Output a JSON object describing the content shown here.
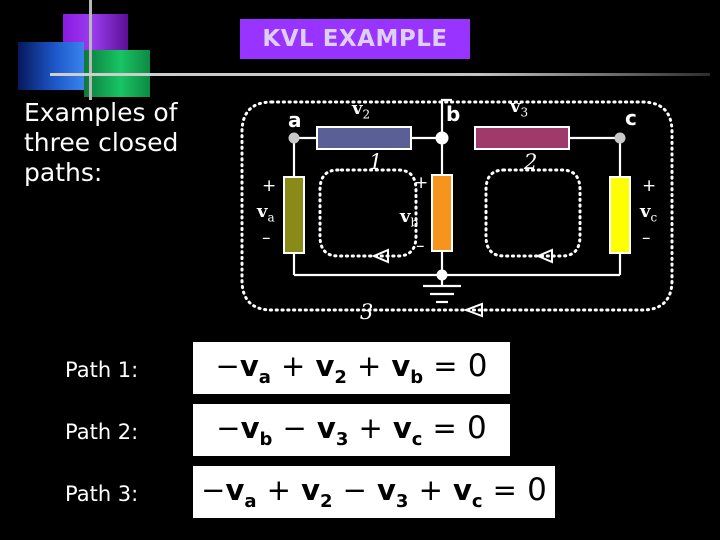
{
  "slide": {
    "title": "KVL EXAMPLE",
    "body_text": "Examples of three closed paths:"
  },
  "colors": {
    "background": "#000000",
    "title_banner": "#9933ff",
    "title_text": "#ded0f5",
    "rule": "#cfcfcf",
    "logo_purple": "#9b3df0",
    "logo_blue": "#1d56c8",
    "logo_green": "#18c463",
    "resistor_v2": "#5a5f96",
    "resistor_v3": "#a03a6b",
    "source_va": "#8a8a18",
    "source_vb": "#f7941e",
    "source_vc": "#ffff00",
    "wire": "#ffffff",
    "node_dot": "#c8c8c8",
    "equation_box": "#ffffff"
  },
  "circuit": {
    "nodes": [
      {
        "id": "node-a",
        "label": "a"
      },
      {
        "id": "node-b",
        "label": "b"
      },
      {
        "id": "node-c",
        "label": "c"
      }
    ],
    "components": [
      {
        "id": "resistor-v2",
        "label": "v",
        "sub": "2",
        "type": "resistor",
        "color": "#5a5f96",
        "orientation": "horizontal"
      },
      {
        "id": "resistor-v3",
        "label": "v",
        "sub": "3",
        "type": "resistor",
        "color": "#a03a6b",
        "orientation": "horizontal"
      },
      {
        "id": "source-va",
        "label": "v",
        "sub": "a",
        "type": "source",
        "color": "#8a8a18",
        "orientation": "vertical",
        "plus": "+",
        "minus": "–"
      },
      {
        "id": "source-vb",
        "label": "v",
        "sub": "b",
        "type": "source",
        "color": "#f7941e",
        "orientation": "vertical",
        "plus": "+",
        "minus": "–"
      },
      {
        "id": "source-vc",
        "label": "v",
        "sub": "c",
        "type": "source",
        "color": "#ffff00",
        "orientation": "vertical",
        "plus": "+",
        "minus": "–"
      }
    ],
    "loops": [
      {
        "id": "loop-1",
        "number": "1"
      },
      {
        "id": "loop-2",
        "number": "2"
      },
      {
        "id": "loop-3",
        "number": "3"
      }
    ],
    "ground": "ground-symbol"
  },
  "paths": [
    {
      "label": "Path 1:",
      "equation": {
        "terms": [
          {
            "op": "−",
            "var": "v",
            "sub": "a"
          },
          {
            "op": "+",
            "var": "v",
            "sub": "2"
          },
          {
            "op": "+",
            "var": "v",
            "sub": "b"
          }
        ],
        "equals": "=",
        "result": "0"
      }
    },
    {
      "label": "Path 2:",
      "equation": {
        "terms": [
          {
            "op": "−",
            "var": "v",
            "sub": "b"
          },
          {
            "op": "−",
            "var": "v",
            "sub": "3"
          },
          {
            "op": "+",
            "var": "v",
            "sub": "c"
          }
        ],
        "equals": "=",
        "result": "0"
      }
    },
    {
      "label": "Path 3:",
      "equation": {
        "terms": [
          {
            "op": "−",
            "var": "v",
            "sub": "a"
          },
          {
            "op": "+",
            "var": "v",
            "sub": "2"
          },
          {
            "op": "−",
            "var": "v",
            "sub": "3"
          },
          {
            "op": "+",
            "var": "v",
            "sub": "c"
          }
        ],
        "equals": "=",
        "result": "0"
      }
    }
  ]
}
